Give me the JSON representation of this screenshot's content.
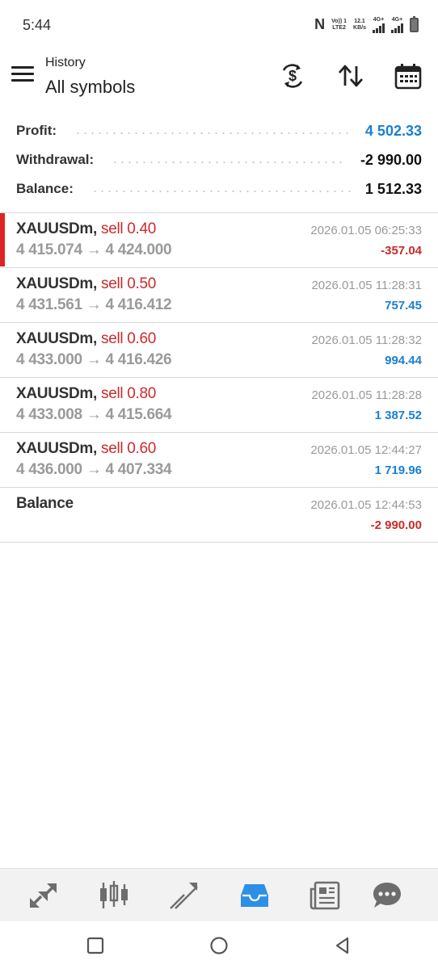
{
  "status_bar": {
    "time": "5:44",
    "carrier_top": "Vo)) 1",
    "carrier_bottom": "LTE2",
    "speed_top": "12.1",
    "speed_bottom": "KB/s",
    "net1": "4G+",
    "net2": "4G+"
  },
  "header": {
    "subtitle": "History",
    "title": "All symbols",
    "icons": [
      "menu-icon",
      "currency-exchange-icon",
      "sort-icon",
      "calendar-icon"
    ]
  },
  "summary": {
    "profit_label": "Profit:",
    "profit_value": "4 502.33",
    "withdrawal_label": "Withdrawal:",
    "withdrawal_value": "-2 990.00",
    "balance_label": "Balance:",
    "balance_value": "1 512.33",
    "profit_color": "#1a7fd2"
  },
  "deals": [
    {
      "symbol": "XAUUSDm,",
      "type": "sell 0.40",
      "prices": "4 415.074 → 4 424.000",
      "time": "2026.01.05 06:25:33",
      "profit": "-357.04"
    },
    {
      "symbol": "XAUUSDm,",
      "type": "sell 0.50",
      "prices": "4 431.561 → 4 416.412",
      "time": "2026.01.05 11:28:31",
      "profit": "757.45"
    },
    {
      "symbol": "XAUUSDm,",
      "type": "sell 0.60",
      "prices": "4 433.000 → 4 416.426",
      "time": "2026.01.05 11:28:32",
      "profit": "994.44"
    },
    {
      "symbol": "XAUUSDm,",
      "type": "sell 0.80",
      "prices": "4 433.008 → 4 415.664",
      "time": "2026.01.05 11:28:28",
      "profit": "1 387.52"
    },
    {
      "symbol": "XAUUSDm,",
      "type": "sell 0.60",
      "prices": "4 436.000 → 4 407.334",
      "time": "2026.01.05 12:44:27",
      "profit": "1 719.96"
    },
    {
      "symbol": "Balance",
      "type": "",
      "prices": "",
      "time": "2026.01.05 12:44:53",
      "profit": "-2 990.00"
    }
  ],
  "bottom_nav": {
    "items": [
      "quotes-icon",
      "chart-icon",
      "trade-icon",
      "history-icon",
      "news-icon",
      "chat-icon"
    ],
    "active": "history-icon",
    "active_color": "#2d8fe6"
  },
  "system_nav": [
    "recent-apps-icon",
    "home-icon",
    "back-icon"
  ],
  "colors": {
    "negative": "#cc2a2a",
    "positive": "#1a7fd2",
    "selection_bar": "#e02424"
  }
}
